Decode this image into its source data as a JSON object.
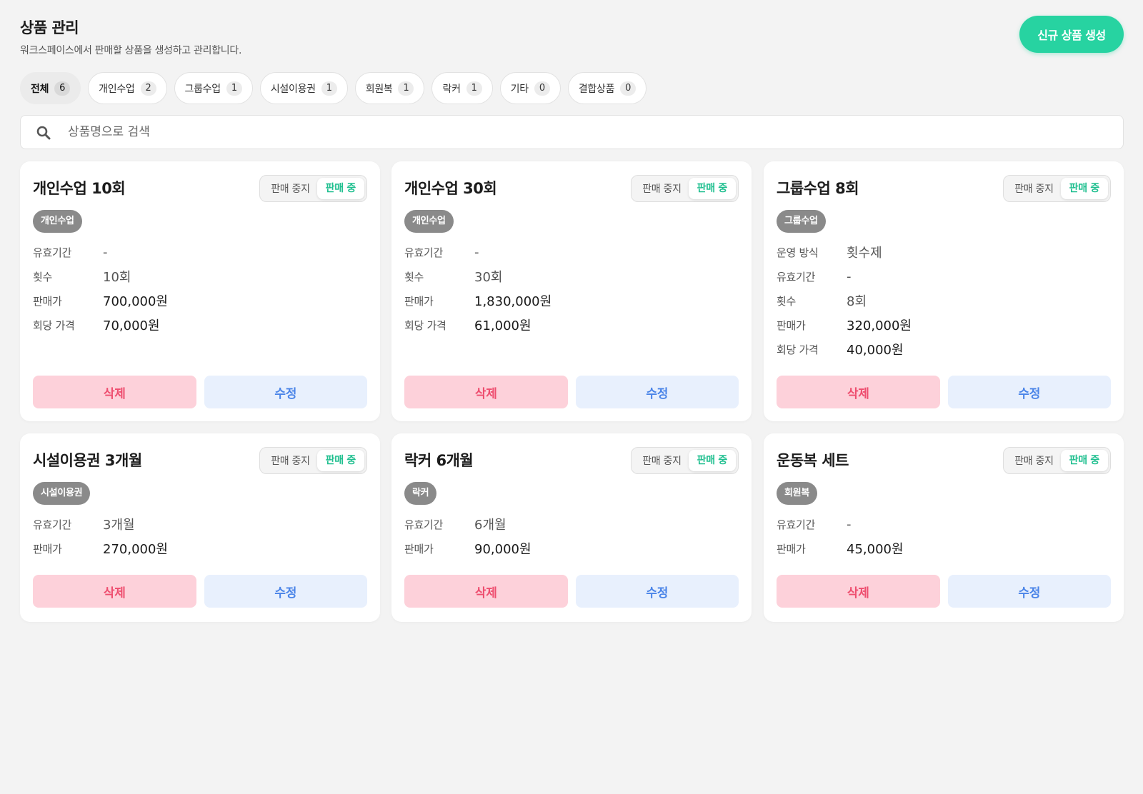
{
  "header": {
    "title": "상품 관리",
    "subtitle": "워크스페이스에서 판매할 상품을 생성하고 관리합니다.",
    "create_label": "신규 상품 생성"
  },
  "filters": [
    {
      "label": "전체",
      "count": "6",
      "active": true
    },
    {
      "label": "개인수업",
      "count": "2"
    },
    {
      "label": "그룹수업",
      "count": "1"
    },
    {
      "label": "시설이용권",
      "count": "1"
    },
    {
      "label": "회원복",
      "count": "1"
    },
    {
      "label": "락커",
      "count": "1"
    },
    {
      "label": "기타",
      "count": "0"
    },
    {
      "label": "결합상품",
      "count": "0"
    }
  ],
  "search": {
    "placeholder": "상품명으로 검색",
    "value": ""
  },
  "toggle": {
    "off_label": "판매 중지",
    "on_label": "판매 중"
  },
  "actions": {
    "delete_label": "삭제",
    "edit_label": "수정"
  },
  "colors": {
    "accent": "#27d3a1",
    "on_sale": "#1fbf8f",
    "delete": "#ee4e6f",
    "edit": "#4a84e8"
  },
  "products": [
    {
      "title": "개인수업 10회",
      "category": "개인수업",
      "status": "판매 중",
      "rows": [
        {
          "label": "유효기간",
          "value": "-"
        },
        {
          "label": "횟수",
          "value": "10회"
        },
        {
          "label": "판매가",
          "value": "700,000원"
        },
        {
          "label": "회당 가격",
          "value": "70,000원"
        }
      ]
    },
    {
      "title": "개인수업 30회",
      "category": "개인수업",
      "status": "판매 중",
      "rows": [
        {
          "label": "유효기간",
          "value": "-"
        },
        {
          "label": "횟수",
          "value": "30회"
        },
        {
          "label": "판매가",
          "value": "1,830,000원"
        },
        {
          "label": "회당 가격",
          "value": "61,000원"
        }
      ]
    },
    {
      "title": "그룹수업 8회",
      "category": "그룹수업",
      "status": "판매 중",
      "rows": [
        {
          "label": "운영 방식",
          "value": "횟수제"
        },
        {
          "label": "유효기간",
          "value": "-"
        },
        {
          "label": "횟수",
          "value": "8회"
        },
        {
          "label": "판매가",
          "value": "320,000원"
        },
        {
          "label": "회당 가격",
          "value": "40,000원"
        }
      ]
    },
    {
      "title": "시설이용권 3개월",
      "category": "시설이용권",
      "status": "판매 중",
      "rows": [
        {
          "label": "유효기간",
          "value": "3개월"
        },
        {
          "label": "판매가",
          "value": "270,000원"
        }
      ]
    },
    {
      "title": "락커 6개월",
      "category": "락커",
      "status": "판매 중",
      "rows": [
        {
          "label": "유효기간",
          "value": "6개월"
        },
        {
          "label": "판매가",
          "value": "90,000원"
        }
      ]
    },
    {
      "title": "운동복 세트",
      "category": "회원복",
      "status": "판매 중",
      "rows": [
        {
          "label": "유효기간",
          "value": "-"
        },
        {
          "label": "판매가",
          "value": "45,000원"
        }
      ]
    }
  ]
}
